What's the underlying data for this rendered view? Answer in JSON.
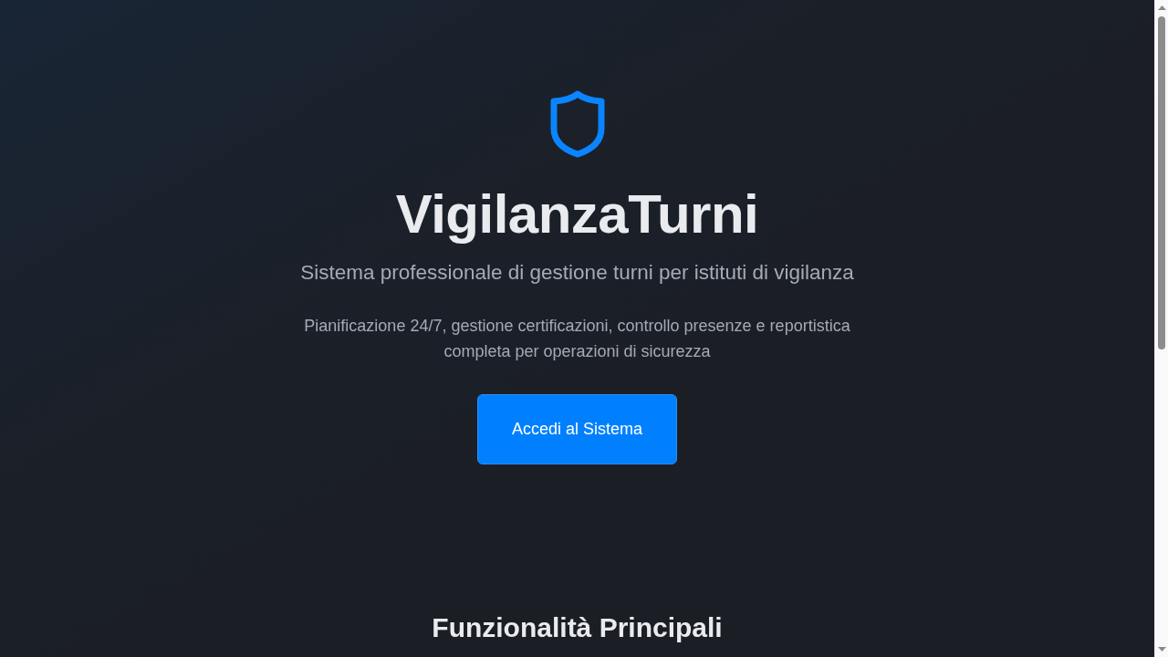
{
  "hero": {
    "title": "VigilanzaTurni",
    "subtitle": "Sistema professionale di gestione turni per istituti di vigilanza",
    "description": "Pianificazione 24/7, gestione certificazioni, controllo presenze e reportistica completa per operazioni di sicurezza",
    "button": "Accedi al Sistema"
  },
  "features": {
    "heading": "Funzionalità Principali"
  }
}
